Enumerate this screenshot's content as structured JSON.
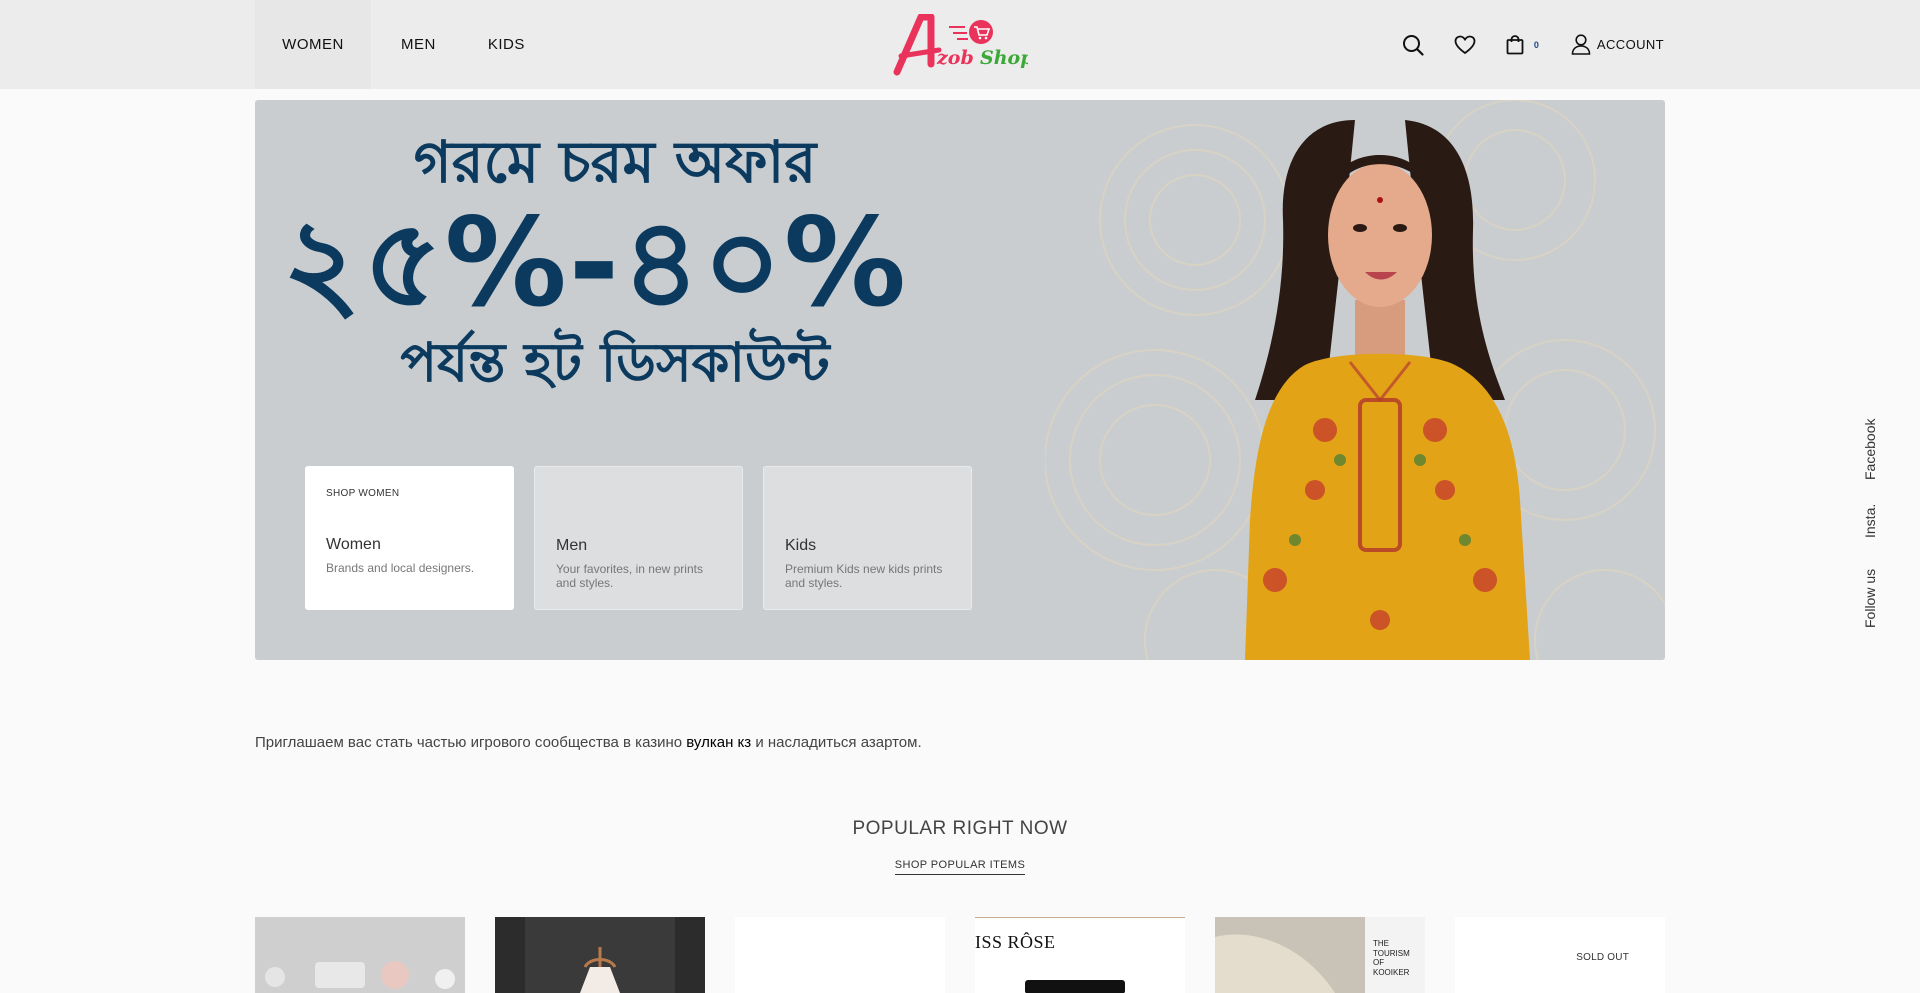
{
  "header": {
    "nav": [
      "WOMEN",
      "MEN",
      "KIDS"
    ],
    "logo_text": "zob Shop",
    "cart_count": "0",
    "account_label": "ACCOUNT"
  },
  "hero": {
    "headline_line1": "গরমে চরম অফার",
    "headline_line2": "২৫%-৪০%",
    "headline_line3": "পর্যন্ত হট ডিসকাউন্ট",
    "cards": [
      {
        "kicker": "SHOP WOMEN",
        "title": "Women",
        "desc": "Brands and local designers."
      },
      {
        "kicker": "",
        "title": "Men",
        "desc": "Your favorites, in new prints and styles."
      },
      {
        "kicker": "",
        "title": "Kids",
        "desc": "Premium Kids new kids prints and styles."
      }
    ]
  },
  "social": [
    "Facebook",
    "Insta.",
    "Follow us"
  ],
  "promo": {
    "before": "Приглашаем вас стать частью игрового сообщества в казино ",
    "link": "вулкан кз",
    "after": " и насладиться азартом."
  },
  "popular": {
    "title": "POPULAR RIGHT NOW",
    "link": "SHOP POPULAR ITEMS"
  },
  "products": {
    "brand_text": "ISS RÔSE",
    "book_text": "THE TOURISM OF KOOIKER",
    "sold_out": "SOLD OUT"
  },
  "colors": {
    "header_bg": "#ececec",
    "hero_bg": "#c9cdd0",
    "headline": "#0b3a5e",
    "dress": "#e2a317",
    "logo_pink": "#e9335b",
    "logo_green": "#3aa935"
  }
}
